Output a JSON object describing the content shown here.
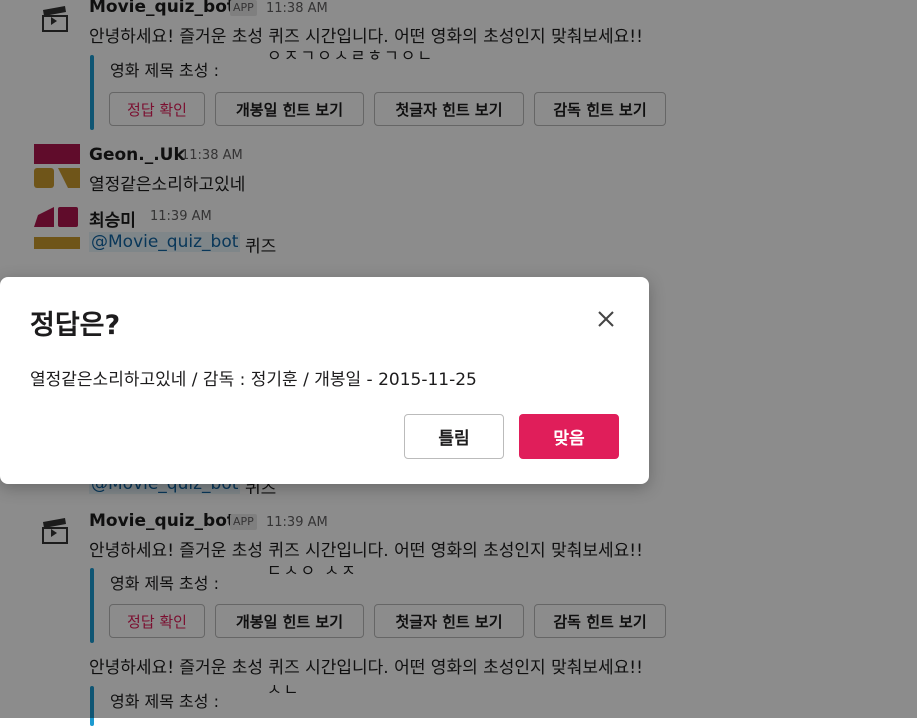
{
  "messages": [
    {
      "name": "Movie_quiz_bot",
      "badge": "APP",
      "time": "11:38 AM",
      "text": "안녕하세요! 즐거운 초성 퀴즈 시간입니다. 어떤 영화의 초성인지 맞춰보세요!!",
      "field_label": "영화 제목 초성 :",
      "field_value": "ㅇㅈㄱㅇㅅㄹㅎㄱㅇㄴ",
      "buttons": [
        "정답 확인",
        "개봉일 힌트 보기",
        "첫글자 힌트 보기",
        "감독 힌트 보기"
      ]
    },
    {
      "name": "Geon._.Uk",
      "time": "11:38 AM",
      "text": "열정같은소리하고있네"
    },
    {
      "name": "최승미",
      "time": "11:39 AM",
      "mention": "@Movie_quiz_bot",
      "text": "퀴즈"
    },
    {
      "name": "Movie_quiz_bot",
      "badge": "APP",
      "time": "11:39 AM",
      "text": "안녕하세요! 즐거운 초성 퀴즈 시간입니다. 어떤 영화의 초성인지 맞춰보세요!!",
      "field_label": "영화 제목 초성 :",
      "field_value": "ㄷㅅㅇ ㅅㅈ",
      "buttons": [
        "정답 확인",
        "개봉일 힌트 보기",
        "첫글자 힌트 보기",
        "감독 힌트 보기"
      ],
      "text2": "안녕하세요! 즐거운 초성 퀴즈 시간입니다. 어떤 영화의 초성인지 맞춰보세요!!",
      "field_label2": "영화 제목 초성 :",
      "field_value2": "ㅅㄴ"
    }
  ],
  "hidden_fragments": {
    "mention_partial": "@Movie_quiz_bot",
    "text_partial": "퀴즈"
  },
  "modal": {
    "title": "정답은?",
    "body": "열정같은소리하고있네 / 감독 : 정기훈 /  개봉일 - 2015-11-25",
    "secondary_label": "틀림",
    "primary_label": "맞음"
  },
  "colors": {
    "accent": "#e01e5a",
    "link": "#1264a3",
    "attachment_bar": "#1d9bd1"
  },
  "icons": [
    "clapperboard-icon",
    "close-icon"
  ]
}
